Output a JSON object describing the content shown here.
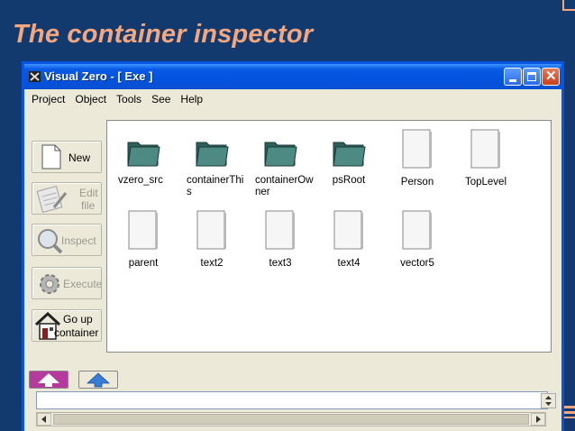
{
  "slide": {
    "title": "The container inspector"
  },
  "window": {
    "title": "Visual Zero - [ Exe ]"
  },
  "menu": [
    "Project",
    "Object",
    "Tools",
    "See",
    "Help"
  ],
  "toolbar": {
    "new": {
      "label": "New"
    },
    "edit_file": {
      "line1": "Edit",
      "line2": "file"
    },
    "inspect": {
      "label": "Inspect"
    },
    "execute": {
      "label": "Execute"
    },
    "go_up": {
      "line1": "Go up",
      "line2": "container"
    }
  },
  "files": [
    {
      "name": "vzero_src",
      "type": "folder-icon"
    },
    {
      "name": "containerThis",
      "type": "folder-icon"
    },
    {
      "name": "containerOwner",
      "type": "folder-icon"
    },
    {
      "name": "psRoot",
      "type": "folder-icon"
    },
    {
      "name": "Person",
      "type": "document-icon"
    },
    {
      "name": "TopLevel",
      "type": "document-icon"
    },
    {
      "name": "parent",
      "type": "document-icon"
    },
    {
      "name": "text2",
      "type": "document-icon"
    },
    {
      "name": "text3",
      "type": "document-icon"
    },
    {
      "name": "text4",
      "type": "document-icon"
    },
    {
      "name": "vector5",
      "type": "document-icon"
    }
  ],
  "status": {
    "value": ""
  },
  "colors": {
    "title_accent": "#f4a77f",
    "titlebar_blue": "#0a54e3",
    "back_button": "#b63a9e",
    "forward_arrow": "#3a7bd5"
  }
}
